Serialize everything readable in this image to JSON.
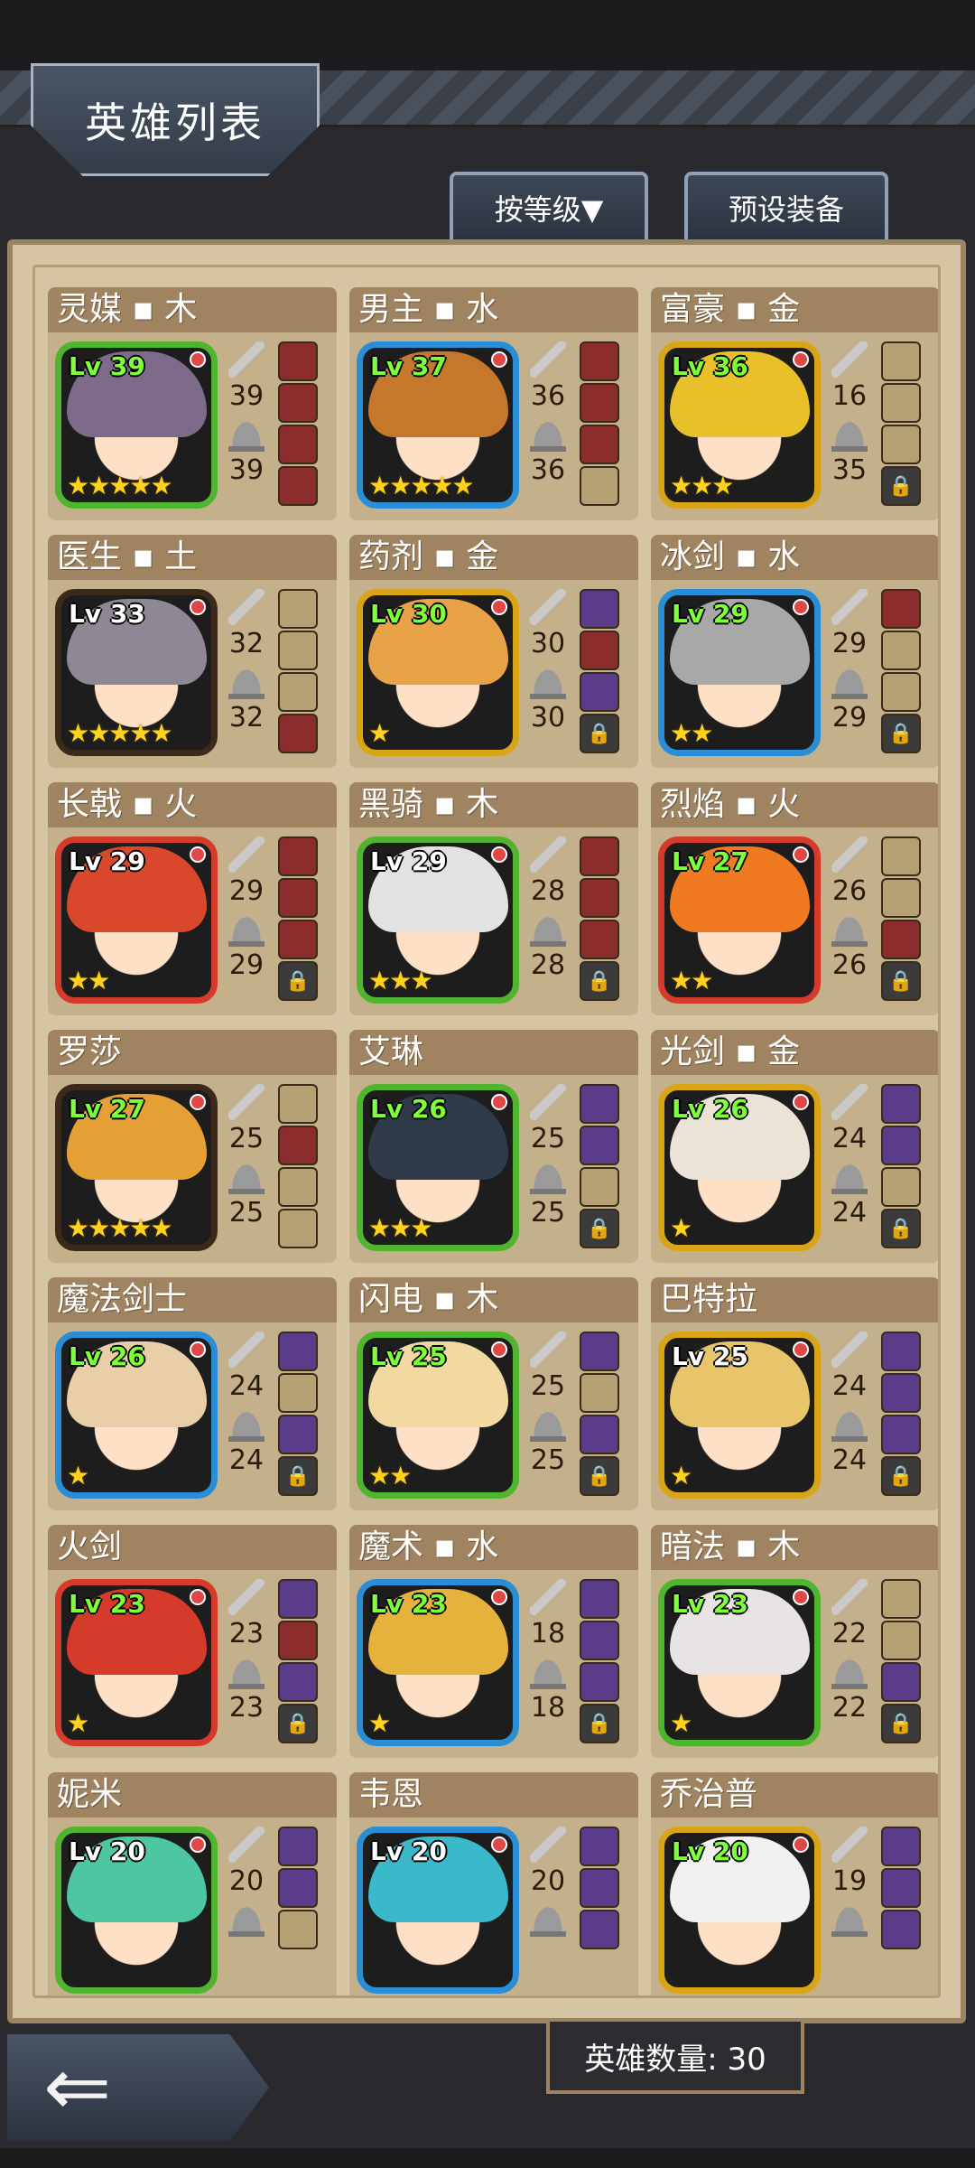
{
  "header": {
    "title": "英雄列表"
  },
  "toolbar": {
    "sort_label": "按等级▼",
    "preset_label": "预设装备"
  },
  "footer": {
    "hero_count": "英雄数量: 30"
  },
  "heroes": [
    {
      "name": "灵媒 ▪ 木",
      "lv": "Lv 39",
      "frame": "#4fb52e",
      "lvcolor": "#7dff3a",
      "stars": "★★★★★",
      "atk": "39",
      "def": "39",
      "hair": "#7e6a8a",
      "slots": [
        "#8b2d2d",
        "#8b2d2d",
        "#8b2d2d",
        "#8b2d2d"
      ],
      "locked": false
    },
    {
      "name": "男主 ▪ 水",
      "lv": "Lv 37",
      "frame": "#2a8ed6",
      "lvcolor": "#7dff3a",
      "stars": "★★★★★",
      "atk": "36",
      "def": "36",
      "hair": "#c5782c",
      "slots": [
        "#8b2d2d",
        "#8b2d2d",
        "#8b2d2d",
        "#b5a073"
      ],
      "locked": false
    },
    {
      "name": "富豪 ▪ 金",
      "lv": "Lv 36",
      "frame": "#d9a516",
      "lvcolor": "#7dff3a",
      "stars": "★★★",
      "atk": "16",
      "def": "35",
      "hair": "#e8c12a",
      "slots": [
        "#b5a073",
        "#b5a073",
        "#b5a073"
      ],
      "locked": true
    },
    {
      "name": "医生 ▪ 土",
      "lv": "Lv 33",
      "frame": "#3b2a1a",
      "lvcolor": "#ffffff",
      "stars": "★★★★★",
      "atk": "32",
      "def": "32",
      "hair": "#8e8794",
      "slots": [
        "#b5a073",
        "#b5a073",
        "#b5a073",
        "#8b2d2d"
      ],
      "locked": false
    },
    {
      "name": "药剂 ▪ 金",
      "lv": "Lv 30",
      "frame": "#d9a516",
      "lvcolor": "#7dff3a",
      "stars": "★",
      "atk": "30",
      "def": "30",
      "hair": "#e8a247",
      "slots": [
        "#5a3c8a",
        "#8b2d2d",
        "#5a3c8a"
      ],
      "locked": true
    },
    {
      "name": "冰剑 ▪ 水",
      "lv": "Lv 29",
      "frame": "#2a8ed6",
      "lvcolor": "#7dff3a",
      "stars": "★★",
      "atk": "29",
      "def": "29",
      "hair": "#a8a8a8",
      "slots": [
        "#8b2d2d",
        "#b5a073",
        "#b5a073"
      ],
      "locked": true
    },
    {
      "name": "长戟 ▪ 火",
      "lv": "Lv 29",
      "frame": "#d63a2a",
      "lvcolor": "#ffffff",
      "stars": "★★",
      "atk": "29",
      "def": "29",
      "hair": "#d9482c",
      "slots": [
        "#8b2d2d",
        "#8b2d2d",
        "#8b2d2d"
      ],
      "locked": true
    },
    {
      "name": "黑骑 ▪ 木",
      "lv": "Lv 29",
      "frame": "#4fb52e",
      "lvcolor": "#ffffff",
      "stars": "★★★",
      "atk": "28",
      "def": "28",
      "hair": "#e2e2e2",
      "slots": [
        "#8b2d2d",
        "#8b2d2d",
        "#8b2d2d"
      ],
      "locked": true
    },
    {
      "name": "烈焰 ▪ 火",
      "lv": "Lv 27",
      "frame": "#d63a2a",
      "lvcolor": "#7dff3a",
      "stars": "★★",
      "atk": "26",
      "def": "26",
      "hair": "#f07a22",
      "slots": [
        "#b5a073",
        "#b5a073",
        "#8b2d2d"
      ],
      "locked": true
    },
    {
      "name": "罗莎",
      "lv": "Lv 27",
      "frame": "#3b2a1a",
      "lvcolor": "#7dff3a",
      "stars": "★★★★★",
      "atk": "25",
      "def": "25",
      "hair": "#e5a035",
      "slots": [
        "#b5a073",
        "#8b2d2d",
        "#b5a073",
        "#b5a073"
      ],
      "locked": false
    },
    {
      "name": "艾琳",
      "lv": "Lv 26",
      "frame": "#4fb52e",
      "lvcolor": "#7dff3a",
      "stars": "★★★",
      "atk": "25",
      "def": "25",
      "hair": "#2f3b49",
      "slots": [
        "#5a3c8a",
        "#5a3c8a",
        "#b5a073"
      ],
      "locked": true
    },
    {
      "name": "光剑 ▪ 金",
      "lv": "Lv 26",
      "frame": "#d9a516",
      "lvcolor": "#7dff3a",
      "stars": "★",
      "atk": "24",
      "def": "24",
      "hair": "#ece3d8",
      "slots": [
        "#5a3c8a",
        "#5a3c8a",
        "#b5a073"
      ],
      "locked": true
    },
    {
      "name": "魔法剑士",
      "lv": "Lv 26",
      "frame": "#2a8ed6",
      "lvcolor": "#7dff3a",
      "stars": "★",
      "atk": "24",
      "def": "24",
      "hair": "#e9cfa8",
      "slots": [
        "#5a3c8a",
        "#b5a073",
        "#5a3c8a"
      ],
      "locked": true
    },
    {
      "name": "闪电 ▪ 木",
      "lv": "Lv 25",
      "frame": "#4fb52e",
      "lvcolor": "#7dff3a",
      "stars": "★★",
      "atk": "25",
      "def": "25",
      "hair": "#f2d9a2",
      "slots": [
        "#5a3c8a",
        "#b5a073",
        "#5a3c8a"
      ],
      "locked": true
    },
    {
      "name": "巴特拉",
      "lv": "Lv 25",
      "frame": "#d9a516",
      "lvcolor": "#ffffff",
      "stars": "★",
      "atk": "24",
      "def": "24",
      "hair": "#e8c46a",
      "slots": [
        "#5a3c8a",
        "#5a3c8a",
        "#5a3c8a"
      ],
      "locked": true
    },
    {
      "name": "火剑",
      "lv": "Lv 23",
      "frame": "#d63a2a",
      "lvcolor": "#7dff3a",
      "stars": "★",
      "atk": "23",
      "def": "23",
      "hair": "#d63a2a",
      "slots": [
        "#5a3c8a",
        "#8b2d2d",
        "#5a3c8a"
      ],
      "locked": true
    },
    {
      "name": "魔术 ▪ 水",
      "lv": "Lv 23",
      "frame": "#2a8ed6",
      "lvcolor": "#7dff3a",
      "stars": "★",
      "atk": "18",
      "def": "18",
      "hair": "#e5b23c",
      "slots": [
        "#5a3c8a",
        "#5a3c8a",
        "#5a3c8a"
      ],
      "locked": true
    },
    {
      "name": "暗法 ▪ 木",
      "lv": "Lv 23",
      "frame": "#4fb52e",
      "lvcolor": "#7dff3a",
      "stars": "★",
      "atk": "22",
      "def": "22",
      "hair": "#e9e4e4",
      "slots": [
        "#b5a073",
        "#b5a073",
        "#5a3c8a"
      ],
      "locked": true
    },
    {
      "name": "妮米",
      "lv": "Lv 20",
      "frame": "#4fb52e",
      "lvcolor": "#ffffff",
      "stars": "",
      "atk": "20",
      "def": "",
      "hair": "#4cc7a2",
      "slots": [
        "#5a3c8a",
        "#5a3c8a",
        "#b5a073"
      ],
      "locked": false
    },
    {
      "name": "韦恩",
      "lv": "Lv 20",
      "frame": "#2a8ed6",
      "lvcolor": "#ffffff",
      "stars": "",
      "atk": "20",
      "def": "",
      "hair": "#39b9c9",
      "slots": [
        "#5a3c8a",
        "#5a3c8a",
        "#5a3c8a"
      ],
      "locked": false
    },
    {
      "name": "乔治普",
      "lv": "Lv 20",
      "frame": "#d9a516",
      "lvcolor": "#7dff3a",
      "stars": "",
      "atk": "19",
      "def": "",
      "hair": "#f1f1f1",
      "slots": [
        "#5a3c8a",
        "#5a3c8a",
        "#5a3c8a"
      ],
      "locked": false
    }
  ]
}
